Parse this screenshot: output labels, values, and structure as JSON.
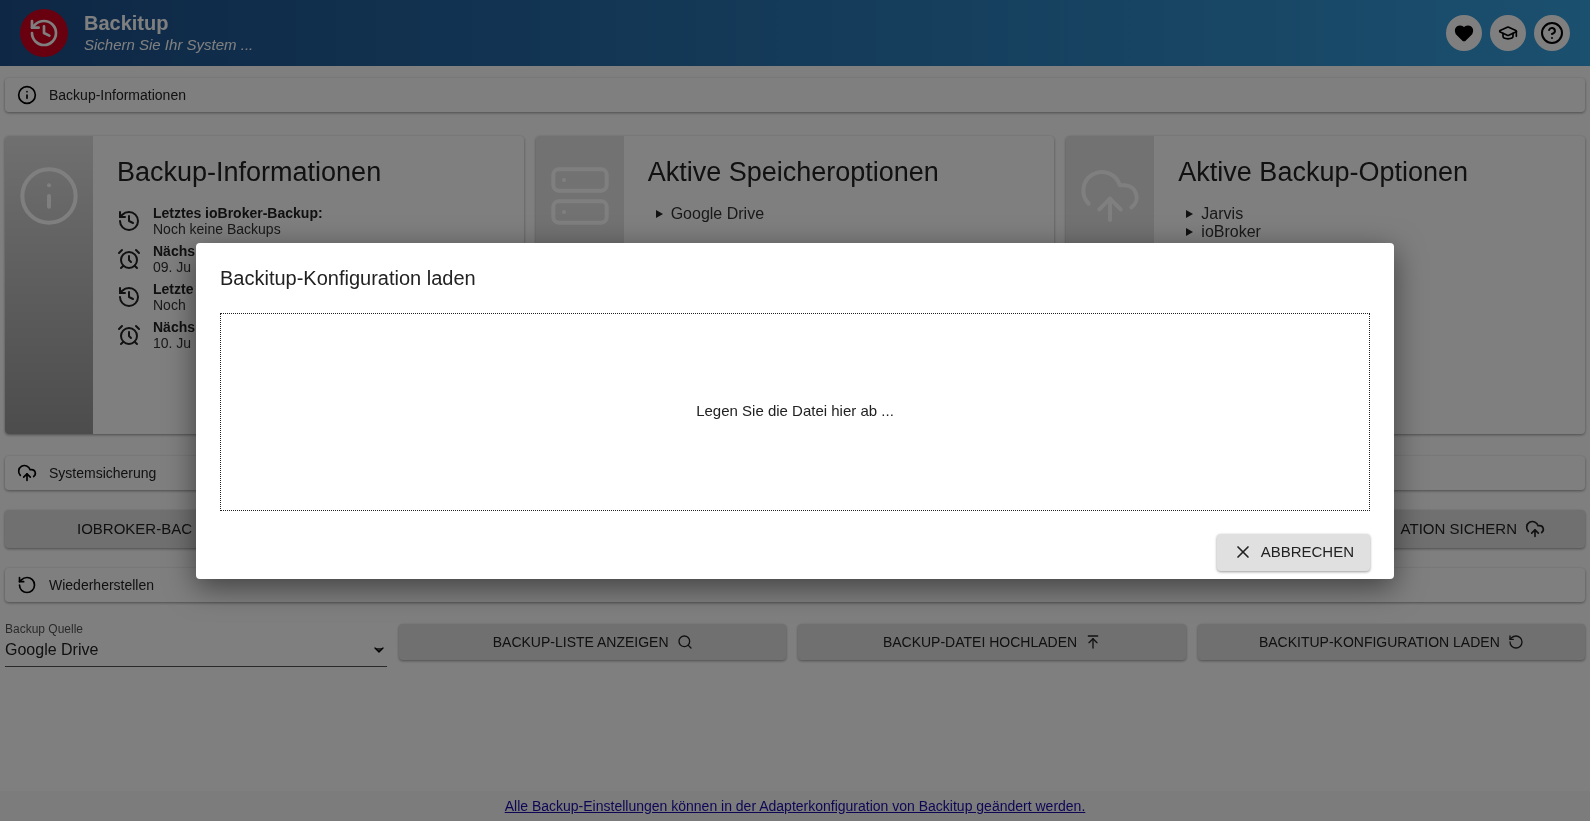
{
  "header": {
    "title": "Backitup",
    "subtitle": "Sichern Sie Ihr System ..."
  },
  "info_section": {
    "label": "Backup-Informationen"
  },
  "cards": [
    {
      "kind": "info",
      "title": "Backup-Informationen",
      "entries": [
        {
          "label": "Letztes ioBroker-Backup:",
          "value": "Noch keine Backups"
        },
        {
          "label": "Nächs",
          "value": "09. Ju"
        },
        {
          "label": "Letzte",
          "value": "Noch"
        },
        {
          "label": "Nächs",
          "value": "10. Ju"
        }
      ]
    },
    {
      "kind": "storage",
      "title": "Aktive Speicheroptionen",
      "items": [
        "Google Drive"
      ]
    },
    {
      "kind": "backup",
      "title": "Aktive Backup-Optionen",
      "items": [
        "Jarvis",
        "ioBroker"
      ]
    }
  ],
  "system_section": {
    "label": "Systemsicherung"
  },
  "backup_buttons": [
    "IOBROKER-BAC",
    "ATION SICHERN"
  ],
  "restore_section": {
    "label": "Wiederherstellen"
  },
  "source_select": {
    "label": "Backup Quelle",
    "value": "Google Drive"
  },
  "restore_buttons": [
    "BACKUP-LISTE ANZEIGEN",
    "BACKUP-DATEI HOCHLADEN",
    "BACKITUP-KONFIGURATION LADEN"
  ],
  "footer_link": "Alle Backup-Einstellungen können in der Adapterkonfiguration von Backitup geändert werden.",
  "dialog": {
    "title": "Backitup-Konfiguration laden",
    "dropzone": "Legen Sie die Datei hier ab ...",
    "cancel": "ABBRECHEN"
  }
}
